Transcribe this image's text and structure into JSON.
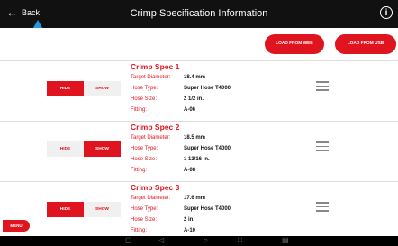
{
  "header": {
    "back_label": "Back",
    "title": "Crimp Specification Information",
    "info_icon": "info-icon"
  },
  "actions": {
    "load_web": "LOAD FROM WEB",
    "load_usb": "LOAD FROM USB"
  },
  "labels": {
    "target_diameter": "Target Diameter:",
    "hose_type": "Hose Type:",
    "hose_size": "Hose Size:",
    "fitting": "Fitting:",
    "hide": "HIDE",
    "show": "SHOW"
  },
  "specs": [
    {
      "name": "Crimp Spec 1",
      "target_diameter": "18.4 mm",
      "hose_type": "Super Hose T4000",
      "hose_size": "2 1/2 in.",
      "fitting": "A-06",
      "active": "hide"
    },
    {
      "name": "Crimp Spec 2",
      "target_diameter": "18.5 mm",
      "hose_type": "Super Hose T4000",
      "hose_size": "1 13/16 in.",
      "fitting": "A-08",
      "active": "show"
    },
    {
      "name": "Crimp Spec 3",
      "target_diameter": "17.6 mm",
      "hose_type": "Super Hose T4000",
      "hose_size": "2 in.",
      "fitting": "A-10",
      "active": "hide"
    }
  ],
  "menu_label": "MENU",
  "colors": {
    "accent": "#e0141e",
    "topbar": "#111111"
  }
}
